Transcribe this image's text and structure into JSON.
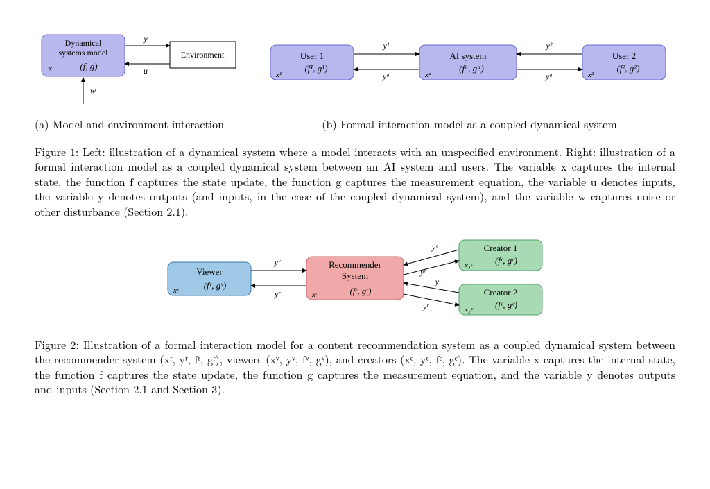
{
  "fig1a": {
    "box_model_l1": "Dynamical",
    "box_model_l2": "systems model",
    "box_model_fg": "(f, g)",
    "box_env": "Environment",
    "lbl_y": "y",
    "lbl_u": "u",
    "lbl_x": "x",
    "lbl_w": "w"
  },
  "fig1b": {
    "user1_title": "User 1",
    "user1_fg": "(f¹, g¹)",
    "ai_title": "AI system",
    "ai_fg": "(fᵃ, gᵃ)",
    "user2_title": "User 2",
    "user2_fg": "(f², g²)",
    "y1": "y¹",
    "ya": "yᵃ",
    "y2": "y²",
    "x1": "x¹",
    "xa": "xᵃ",
    "x2": "x²"
  },
  "subcap_a": "(a) Model and environment interaction",
  "subcap_b": "(b) Formal interaction model as a coupled dynamical system",
  "fig1_caption_lead": "Figure 1:",
  "fig1_caption_text": " Left: illustration of a dynamical system where a model interacts with an unspecified environment. Right: illustration of a formal interaction model as a coupled dynamical system between an AI system and users. The variable x captures the internal state, the function f captures the state update, the function g captures the measurement equation, the variable u denotes inputs, the variable y denotes outputs (and inputs, in the case of the coupled dynamical system), and the variable w captures noise or other disturbance (Section 2.1).",
  "fig2": {
    "viewer_title": "Viewer",
    "viewer_fg": "(fᵛ, gᵛ)",
    "rec_l1": "Recommender",
    "rec_l2": "System",
    "rec_fg": "(fʳ, gʳ)",
    "c1_title": "Creator 1",
    "c1_fg": "(fᶜ, gᶜ)",
    "c2_title": "Creator 2",
    "c2_fg": "(fᶜ, gᶜ)",
    "yv": "yᵛ",
    "yr": "yʳ",
    "yc": "yᶜ",
    "xv": "xᵛ",
    "xr": "xʳ",
    "xc1": "x₁ᶜ",
    "xc2": "x₂ᶜ"
  },
  "fig2_caption_lead": "Figure 2:",
  "fig2_caption_text": " Illustration of a formal interaction model for a content recommendation system as a coupled dynamical system between the recommender system (xʳ, yʳ, fʳ, gʳ), viewers (xᵛ, yᵛ, fᵛ, gᵛ), and creators (xᶜ, yᶜ, fᶜ, gᶜ). The variable x captures the internal state, the function f captures the state update, the function g captures the measurement equation, and the variable y denotes outputs and inputs (Section 2.1 and Section 3)."
}
